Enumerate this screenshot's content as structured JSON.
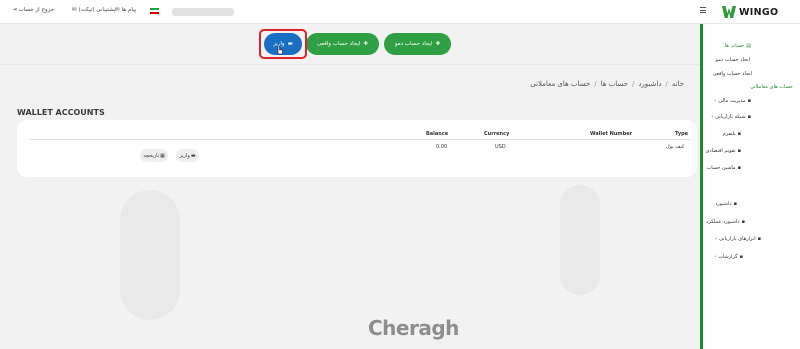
{
  "topbar": {
    "logout": "خروج از حساب",
    "support": "پشتیبانی (تیکت)",
    "messages": "پیام ها"
  },
  "logo": {
    "text": "WINGO"
  },
  "sidebar": {
    "accounts": "حساب ها",
    "sub": [
      "ایجاد حساب دمو",
      "ایجاد حساب واقعی",
      "حساب های معاملاتی"
    ],
    "items": [
      "مدیریت مالی",
      "شبکه بازاریابی",
      "پلتفرم",
      "تقویم اقتصادی",
      "ماشین حساب",
      "داشبورد",
      "داشبورد عملکرد",
      "ابزارهای بازاریابی",
      "گزارشات"
    ]
  },
  "buttons": {
    "demo": "ایجاد حساب دمو",
    "real": "ایجاد حساب واقعی",
    "deposit": "واریز"
  },
  "breadcrumb": [
    "خانه",
    "داشبورد",
    "حساب ها",
    "حساب های معاملاتی"
  ],
  "section_title": "WALLET ACCOUNTS",
  "table": {
    "headers": {
      "type": "Type",
      "wallet": "Wallet Number",
      "currency": "Currency",
      "balance": "Balance"
    },
    "row": {
      "type": "کیف پول",
      "wallet": "",
      "currency": "USD",
      "balance": "0.00"
    },
    "actions": {
      "deposit": "واریز",
      "history": "تاریخچه"
    }
  },
  "watermark": "Cheragh",
  "colors": {
    "green": "#2ea043",
    "blue": "#1b6fc2",
    "highlight": "#e0202a"
  }
}
